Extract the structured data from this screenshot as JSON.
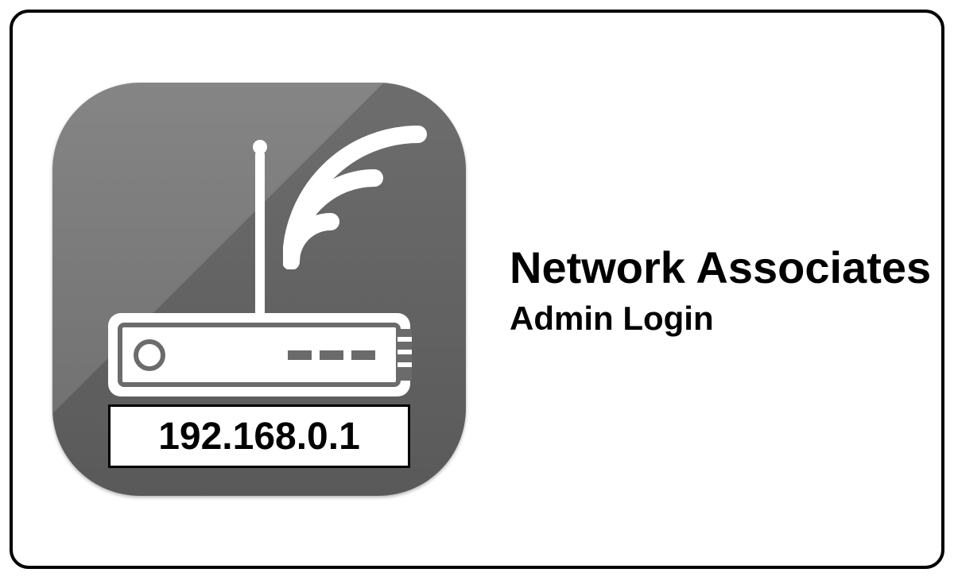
{
  "title": "Network Associates",
  "subtitle": "Admin Login",
  "ip_address": "192.168.0.1",
  "icon": {
    "name": "wifi-router-icon",
    "bg_gradient_top": "#858585",
    "bg_gradient_bottom": "#6d6d6d"
  }
}
